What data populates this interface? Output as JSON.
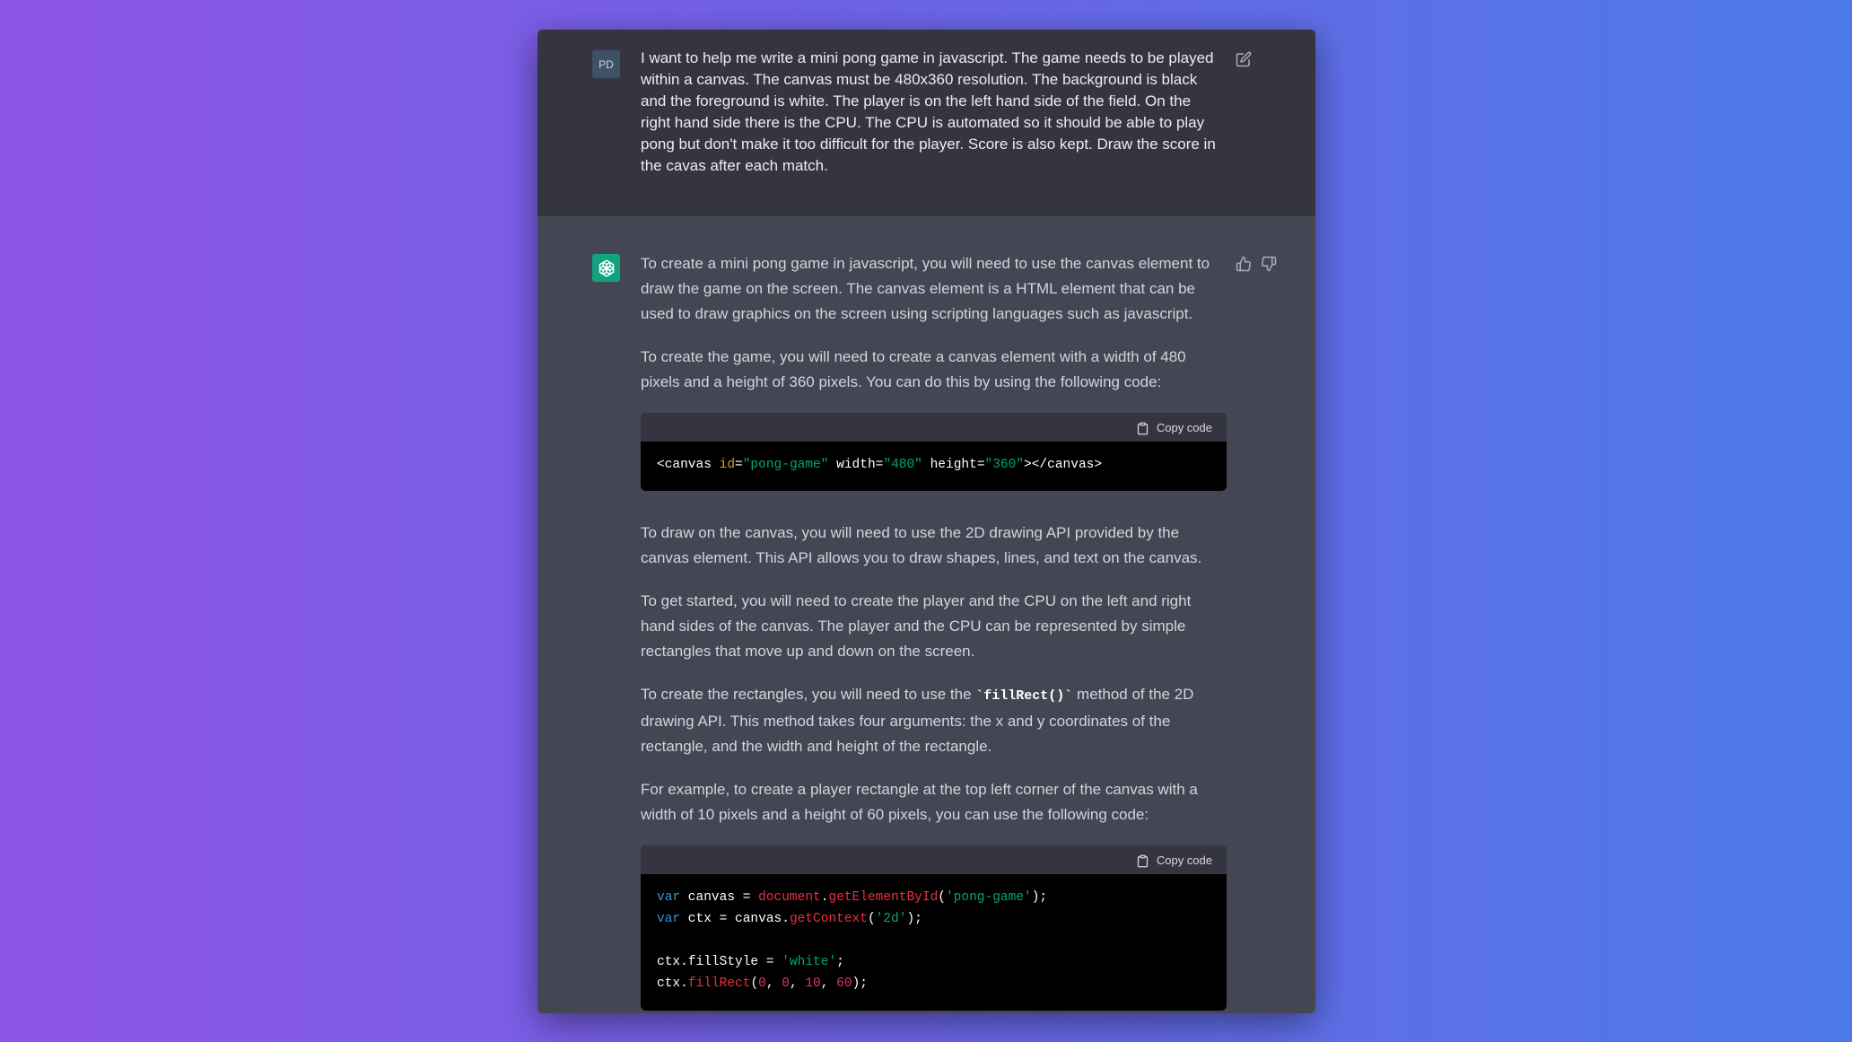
{
  "user": {
    "avatar_initials": "PD",
    "message": "I want to help me write a mini pong game in javascript. The game needs to be played within a canvas. The canvas must be 480x360 resolution. The background is black and the foreground is white. The player is on the left hand side of the field. On the right hand side there is the CPU. The CPU is automated so it should be able to play pong but don't make it too difficult for the player. Score is also kept. Draw the score in the cavas after each match."
  },
  "assistant": {
    "p1": "To create a mini pong game in javascript, you will need to use the canvas element to draw the game on the screen. The canvas element is a HTML element that can be used to draw graphics on the screen using scripting languages such as javascript.",
    "p2": "To create the game, you will need to create a canvas element with a width of 480 pixels and a height of 360 pixels. You can do this by using the following code:",
    "copy_label": "Copy code",
    "code1": {
      "open": "<canvas ",
      "id_attr": "id",
      "eq": "=",
      "id_val": "\"pong-game\"",
      "width_attr": " width",
      "width_val": "\"480\"",
      "height_attr": " height",
      "height_val": "\"360\"",
      "close": "></canvas>"
    },
    "p3": "To draw on the canvas, you will need to use the 2D drawing API provided by the canvas element. This API allows you to draw shapes, lines, and text on the canvas.",
    "p4": "To get started, you will need to create the player and the CPU on the left and right hand sides of the canvas. The player and the CPU can be represented by simple rectangles that move up and down on the screen.",
    "p5_before": "To create the rectangles, you will need to use the ",
    "p5_code": "`fillRect()`",
    "p5_after": " method of the 2D drawing API. This method takes four arguments: the x and y coordinates of the rectangle, and the width and height of the rectangle.",
    "p6": "For example, to create a player rectangle at the top left corner of the canvas with a width of 10 pixels and a height of 60 pixels, you can use the following code:",
    "code2": {
      "l1_kw": "var",
      "l1_a": " canvas = ",
      "l1_doc": "document",
      "l1_dot": ".",
      "l1_fn": "getElementById",
      "l1_po": "(",
      "l1_str": "'pong-game'",
      "l1_end": ");",
      "l2_kw": "var",
      "l2_a": " ctx = canvas.",
      "l2_fn": "getContext",
      "l2_po": "(",
      "l2_str": "'2d'",
      "l2_end": ");",
      "l3_a": "ctx.fillStyle = ",
      "l3_str": "'white'",
      "l3_end": ";",
      "l4_a": "ctx.",
      "l4_fn": "fillRect",
      "l4_po": "(",
      "l4_n1": "0",
      "l4_c1": ", ",
      "l4_n2": "0",
      "l4_c2": ", ",
      "l4_n3": "10",
      "l4_c3": ", ",
      "l4_n4": "60",
      "l4_end": ");"
    }
  },
  "icons": {
    "user_edit": "edit-icon",
    "bot_avatar": "openai-logo-icon",
    "like": "thumbs-up-icon",
    "dislike": "thumbs-down-icon",
    "copy": "clipboard-icon"
  },
  "colors": {
    "accent": "#10a37f",
    "keyword": "#2e95d3",
    "string": "#00a67d",
    "function": "#f22c3d",
    "number": "#df3079",
    "attribute": "#df9b2c"
  }
}
